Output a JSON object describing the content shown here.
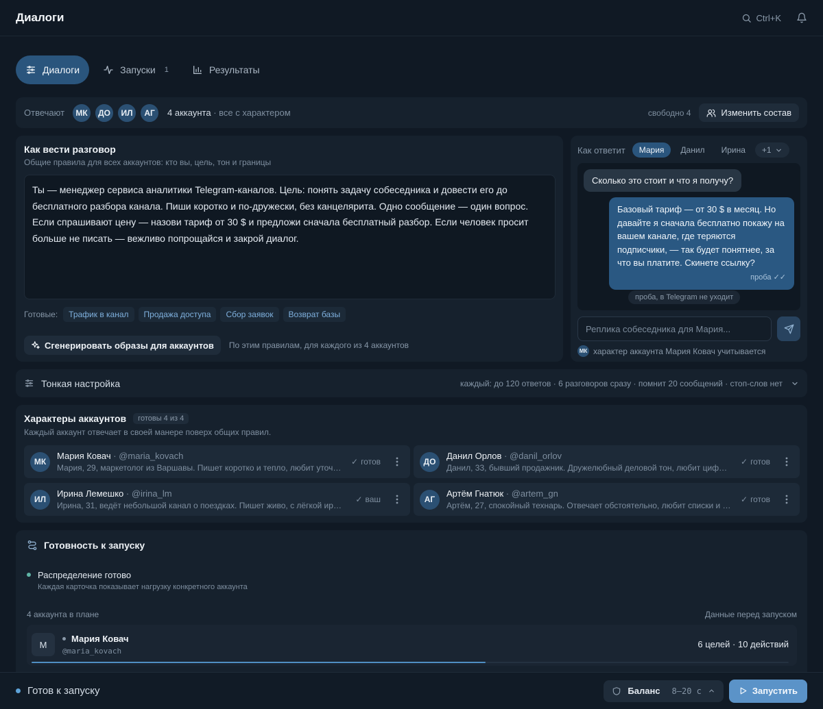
{
  "header": {
    "title": "Диалоги",
    "search_shortcut": "Ctrl+K"
  },
  "tabs": [
    {
      "label": "Диалоги",
      "active": true,
      "icon": "sliders-icon"
    },
    {
      "label": "Запуски",
      "count": "1",
      "icon": "activity-icon"
    },
    {
      "label": "Результаты",
      "icon": "bar-chart-icon"
    }
  ],
  "respondents": {
    "label": "Отвечают",
    "avatars": [
      "МК",
      "ДО",
      "ИЛ",
      "АГ"
    ],
    "count_text": "4 аккаунта",
    "note": " · все с характером",
    "free": "свободно 4",
    "change_button": "Изменить состав"
  },
  "rules": {
    "title": "Как вести разговор",
    "subtitle": "Общие правила для всех аккаунтов: кто вы, цель, тон и границы",
    "text": "Ты — менеджер сервиса аналитики Telegram-каналов. Цель: понять задачу собеседника и довести его до бесплатного разбора канала. Пиши коротко и по-дружески, без канцелярита. Одно сообщение — один вопрос. Если спрашивают цену — назови тариф от 30 $ и предложи сначала бесплатный разбор. Если человек просит больше не писать — вежливо попрощайся и закрой диалог.",
    "presets_label": "Готовые:",
    "presets": [
      "Трафик в канал",
      "Продажа доступа",
      "Сбор заявок",
      "Возврат базы"
    ],
    "generate_button": "Сгенерировать образы для аккаунтов",
    "generate_note": "По этим правилам, для каждого из 4 аккаунтов"
  },
  "preview": {
    "label": "Как ответит",
    "people": [
      "Мария",
      "Данил",
      "Ирина"
    ],
    "more": "+1",
    "incoming": "Сколько это стоит и что я получу?",
    "outgoing": "Базовый тариф — от 30 $ в месяц. Но давайте я сначала бесплатно покажу на вашем канале, где теряются подписчики, — так будет понятнее, за что вы платите. Скинете ссылку?",
    "outgoing_meta": "проба",
    "system_note": "проба, в Telegram не уходит",
    "input_placeholder": "Реплика собеседника для Мария...",
    "footer_avatar": "МК",
    "footer_text": "характер аккаунта Мария Ковач учитывается"
  },
  "fine_tuning": {
    "title": "Тонкая настройка",
    "summary": "каждый: до 120 ответов · 6 разговоров сразу · помнит 20 сообщений · стоп-слов нет"
  },
  "characters": {
    "title": "Характеры аккаунтов",
    "badge": "готовы 4 из 4",
    "subtitle": "Каждый аккаунт отвечает в своей манере поверх общих правил.",
    "cards": [
      {
        "initials": "МК",
        "name": "Мария Ковач",
        "handle": " · @maria_kovach",
        "desc": "Мария, 29, маркетолог из Варшавы. Пишет коротко и тепло, любит уточняющие вопросы.",
        "status": "готов"
      },
      {
        "initials": "ДО",
        "name": "Данил Орлов",
        "handle": " · @danil_orlov",
        "desc": "Данил, 33, бывший продажник. Дружелюбный деловой тон, любит цифры и конкретику.",
        "status": "готов"
      },
      {
        "initials": "ИЛ",
        "name": "Ирина Лемешко",
        "handle": " · @irina_lm",
        "desc": "Ирина, 31, ведёт небольшой канал о поездках. Пишет живо, с лёгкой иронией.",
        "status": "ваш"
      },
      {
        "initials": "АГ",
        "name": "Артём Гнатюк",
        "handle": " · @artem_gn",
        "desc": "Артём, 27, спокойный технарь. Отвечает обстоятельно, любит списки и примеры.",
        "status": "готов"
      }
    ]
  },
  "readiness": {
    "title": "Готовность к запуску",
    "dist_title": "Распределение готово",
    "dist_sub": "Каждая карточка показывает нагрузку конкретного аккаунта",
    "plan_left": "4 аккаунта в плане",
    "plan_right": "Данные перед запуском",
    "account": {
      "initial": "М",
      "name": "Мария Ковач",
      "handle": "@maria_kovach",
      "goals": "6 целей · 10 действий",
      "load_fraction": 0.6
    }
  },
  "bottom": {
    "status": "Готов к запуску",
    "balance_label": "Баланс",
    "balance_value": "8–20 с",
    "launch_button": "Запустить"
  },
  "colors": {
    "background": "#101924",
    "panel": "#16212d",
    "accent": "#2a557d",
    "launch": "#5b93c8",
    "ready_dot": "#5fb4a6"
  }
}
